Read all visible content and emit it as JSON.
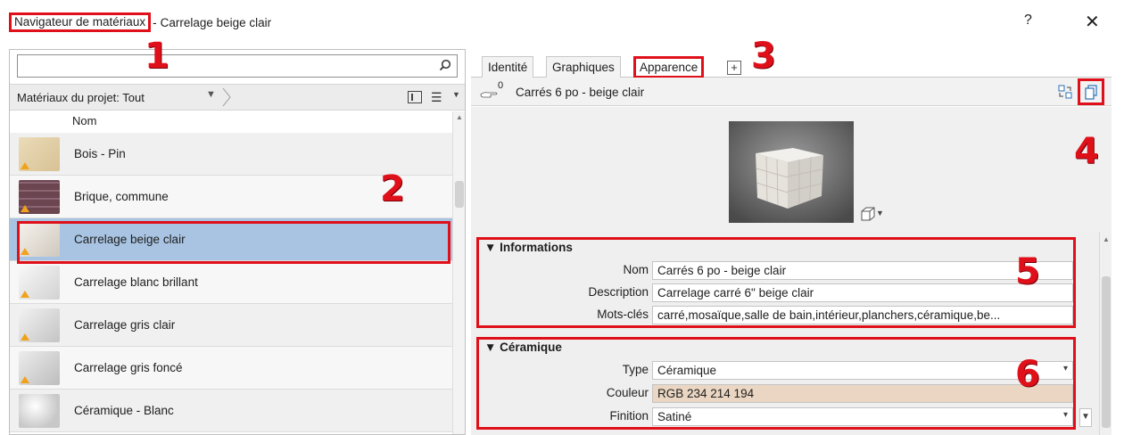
{
  "window": {
    "title": "Navigateur de matériaux",
    "separator": "-",
    "subtitle": "Carrelage beige clair",
    "help_label": "?",
    "close_label": "✕"
  },
  "search": {
    "value": "",
    "placeholder": ""
  },
  "filter": {
    "label": "Matériaux du projet: Tout"
  },
  "list": {
    "column_header": "Nom",
    "items": [
      {
        "label": "Bois - Pin",
        "thumb": "wood"
      },
      {
        "label": "Brique, commune",
        "thumb": "brick"
      },
      {
        "label": "Carrelage beige clair",
        "thumb": "tile-beige",
        "selected": true
      },
      {
        "label": "Carrelage blanc brillant",
        "thumb": "tile-white"
      },
      {
        "label": "Carrelage gris clair",
        "thumb": "tile-lightgray"
      },
      {
        "label": "Carrelage gris foncé",
        "thumb": "tile-darkgray"
      },
      {
        "label": "Céramique - Blanc",
        "thumb": "ceramic-white"
      }
    ]
  },
  "tabs": [
    {
      "label": "Identité"
    },
    {
      "label": "Graphiques"
    },
    {
      "label": "Apparence",
      "active": true
    }
  ],
  "tab_add_label": "+",
  "asset": {
    "count": "0",
    "name": "Carrés 6 po - beige clair"
  },
  "info": {
    "title": "Informations",
    "rows": [
      {
        "label": "Nom",
        "value": "Carrés 6 po - beige clair"
      },
      {
        "label": "Description",
        "value": "Carrelage carré 6\" beige clair"
      },
      {
        "label": "Mots-clés",
        "value": "carré,mosaïque,salle de bain,intérieur,planchers,céramique,be..."
      }
    ]
  },
  "ceramic": {
    "title": "Céramique",
    "rows": [
      {
        "label": "Type",
        "value": "Céramique"
      },
      {
        "label": "Couleur",
        "value": "RGB 234 214 194",
        "swatch": "#EAD6C2"
      },
      {
        "label": "Finition",
        "value": "Satiné"
      }
    ]
  },
  "callouts": [
    "1",
    "2",
    "3",
    "4",
    "5",
    "6"
  ],
  "colors": {
    "accent_red": "#E0101A",
    "selection_blue": "#A8C4E2",
    "tile_color": "#EAD6C2"
  }
}
